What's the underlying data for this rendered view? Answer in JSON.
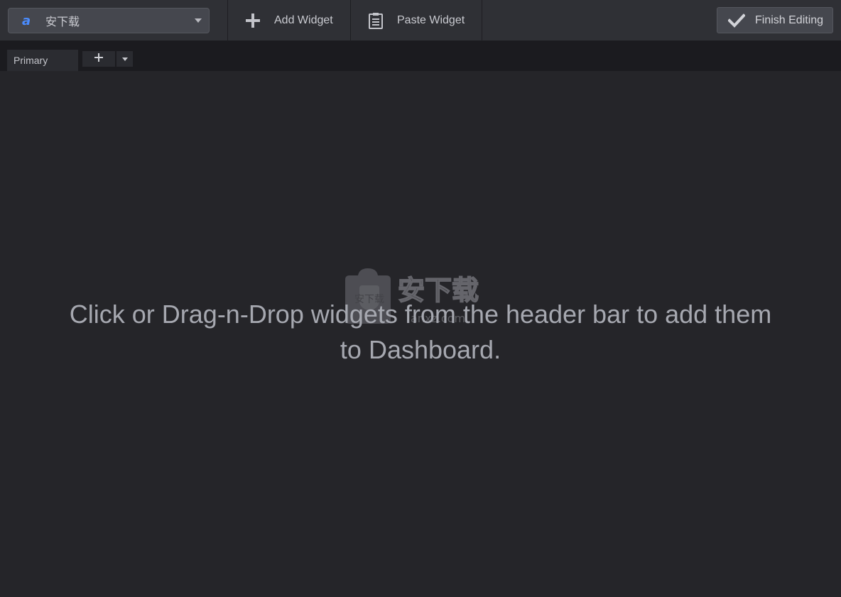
{
  "header": {
    "dashboard_select": {
      "logo_icon": "a-logo-icon",
      "name": "安下载"
    },
    "add_widget": {
      "icon": "plus-icon",
      "label": "Add Widget"
    },
    "paste_widget": {
      "icon": "clipboard-icon",
      "label": "Paste Widget"
    },
    "finish_editing": {
      "icon": "checkmark-icon",
      "label": "Finish Editing"
    }
  },
  "tabs": {
    "items": [
      {
        "label": "Primary",
        "active": true
      }
    ],
    "add_icon": "plus-icon",
    "menu_icon": "caret-down-icon"
  },
  "canvas": {
    "empty_message": "Click or Drag-n-Drop widgets from the header bar to add them to Dashboard."
  },
  "watermark": {
    "text": "安下载",
    "subtext": "anxz.com"
  },
  "colors": {
    "header_bg": "#2f3035",
    "canvas_bg": "#252529",
    "tabstrip_bg": "#1b1b1f",
    "button_bg": "#45474e",
    "logo_accent": "#4a8cff",
    "text": "#c9cad0"
  }
}
